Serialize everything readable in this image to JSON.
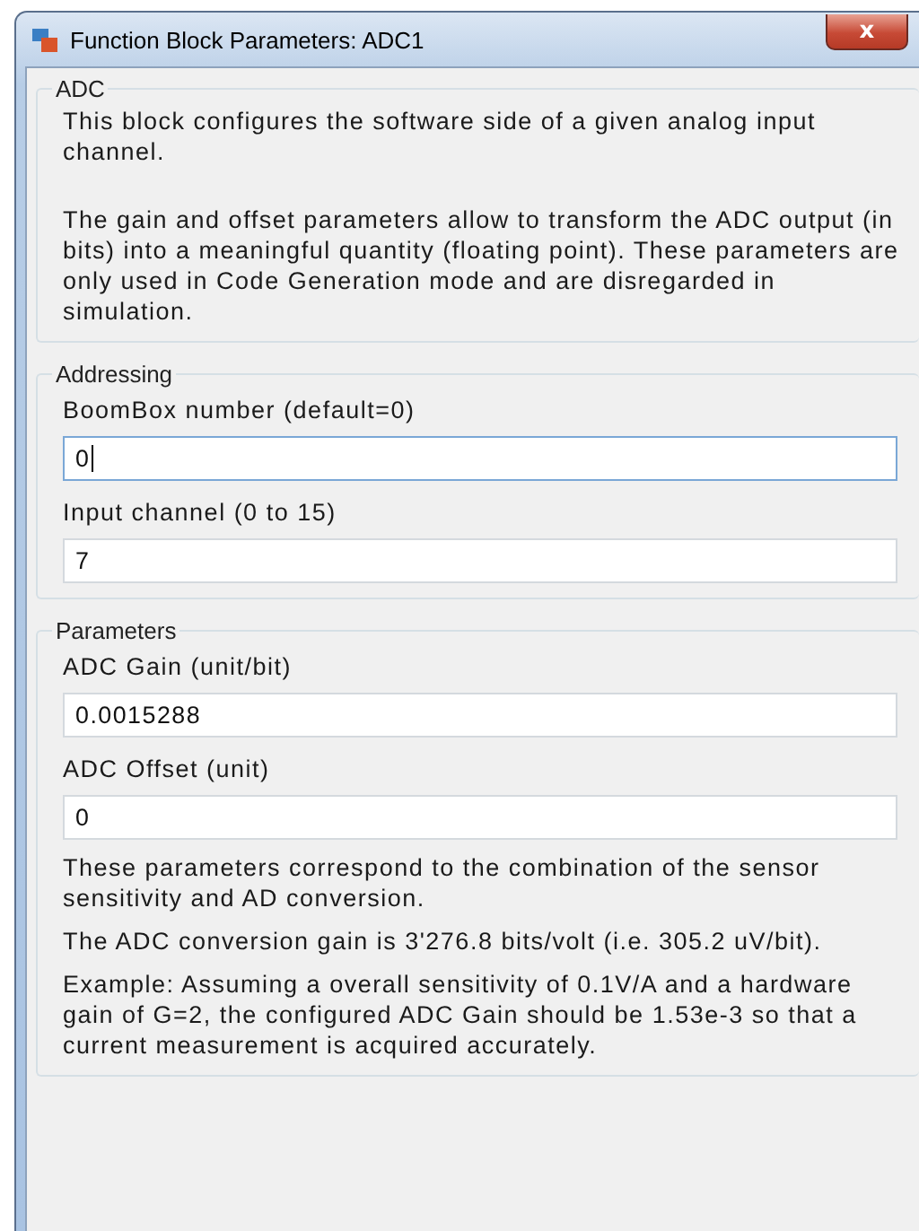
{
  "window": {
    "title": "Function Block Parameters: ADC1",
    "close": "x"
  },
  "groups": [
    {
      "title": "ADC",
      "items": [
        {
          "kind": "text",
          "text": "This block configures the software side of a given analog input channel."
        },
        {
          "kind": "text",
          "text": "The gain and offset parameters allow to transform the ADC output (in bits) into a meaningful quantity (floating point). These parameters are only used in Code Generation mode and are disregarded in simulation.",
          "gap": true
        }
      ]
    },
    {
      "title": "Addressing",
      "items": [
        {
          "kind": "field",
          "label": "BoomBox number (default=0)",
          "value": "0",
          "focused": true
        },
        {
          "kind": "field",
          "label": "Input channel (0 to 15)",
          "value": "7",
          "focused": false
        }
      ]
    },
    {
      "title": "Parameters",
      "items": [
        {
          "kind": "field",
          "label": "ADC Gain (unit/bit)",
          "value": "0.0015288",
          "focused": false
        },
        {
          "kind": "field",
          "label": "ADC Offset (unit)",
          "value": "0",
          "focused": false
        },
        {
          "kind": "text",
          "text": "These parameters correspond to the combination of the sensor sensitivity and AD conversion."
        },
        {
          "kind": "text",
          "text": "The ADC conversion gain is 3'276.8 bits/volt (i.e. 305.2 uV/bit)."
        },
        {
          "kind": "text",
          "text": "Example: Assuming a overall sensitivity of 0.1V/A and a hardware gain of G=2, the configured ADC Gain should be 1.53e-3 so that a current measurement is acquired accurately."
        }
      ]
    }
  ]
}
